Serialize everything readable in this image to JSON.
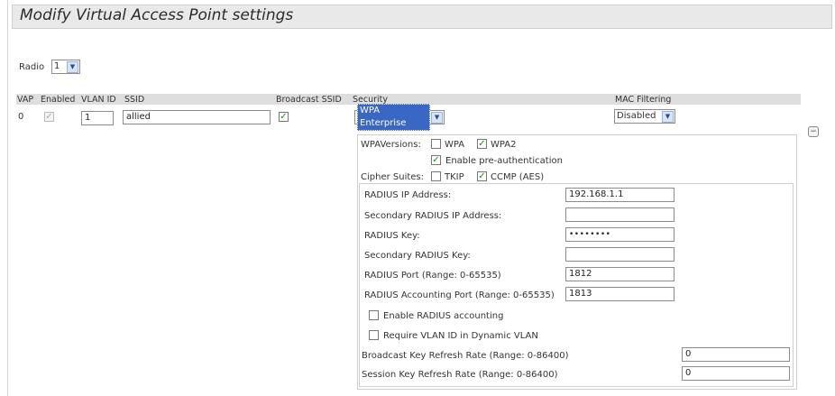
{
  "page": {
    "title": "Modify Virtual Access Point settings"
  },
  "radio": {
    "label": "Radio",
    "value": "1"
  },
  "table": {
    "headers": {
      "vap": "VAP",
      "enabled": "Enabled",
      "vlan_id": "VLAN ID",
      "ssid": "SSID",
      "broadcast_ssid": "Broadcast SSID",
      "security": "Security",
      "mac_filtering": "MAC Filtering"
    },
    "row": {
      "vap": "0",
      "enabled": true,
      "vlan_id": "1",
      "ssid": "allied",
      "broadcast_ssid": true,
      "security": "WPA Enterprise",
      "mac_filtering": "Disabled"
    }
  },
  "security_panel": {
    "wpa_versions_label": "WPAVersions:",
    "wpa_label": "WPA",
    "wpa_checked": false,
    "wpa2_label": "WPA2",
    "wpa2_checked": true,
    "preauth_label": "Enable pre-authentication",
    "preauth_checked": true,
    "cipher_label": "Cipher Suites:",
    "tkip_label": "TKIP",
    "tkip_checked": false,
    "ccmp_label": "CCMP (AES)",
    "ccmp_checked": true
  },
  "radius": {
    "ip_label": "RADIUS IP Address:",
    "ip_value": "192.168.1.1",
    "secondary_ip_label": "Secondary RADIUS IP Address:",
    "secondary_ip_value": "",
    "key_label": "RADIUS Key:",
    "key_value": "••••••••",
    "secondary_key_label": "Secondary RADIUS Key:",
    "secondary_key_value": "",
    "port_label": "RADIUS Port (Range: 0-65535)",
    "port_value": "1812",
    "acct_port_label": "RADIUS Accounting Port (Range: 0-65535)",
    "acct_port_value": "1813",
    "enable_accounting_label": "Enable RADIUS accounting",
    "enable_accounting_checked": false,
    "require_vlan_label": "Require VLAN ID in Dynamic VLAN",
    "require_vlan_checked": false
  },
  "refresh": {
    "broadcast_label": "Broadcast Key Refresh Rate (Range: 0-86400)",
    "broadcast_value": "0",
    "session_label": "Session Key Refresh Rate (Range: 0-86400)",
    "session_value": "0"
  },
  "icons": {
    "collapse": "collapse-icon",
    "dropdown": "chevron-down-icon"
  }
}
